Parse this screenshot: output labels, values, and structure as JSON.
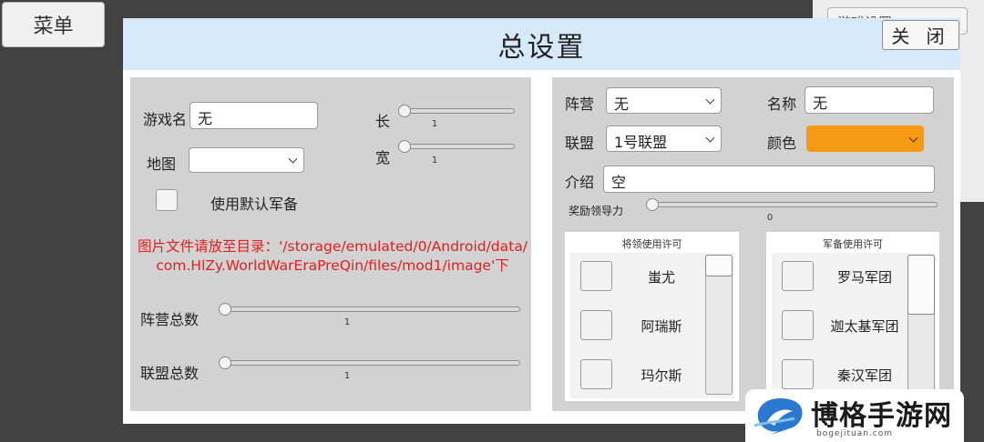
{
  "background": {
    "menu_button_label": "菜单",
    "right_dropdown_label": "游戏设置"
  },
  "dialog": {
    "title": "总设置",
    "close_label": "关 闭"
  },
  "left_panel": {
    "game_name_label": "游戏名",
    "game_name_value": "无",
    "length_label": "长",
    "length_value": "1",
    "width_label": "宽",
    "width_value": "1",
    "map_label": "地图",
    "map_value": "",
    "default_army_label": "使用默认军备",
    "default_army_checked": false,
    "image_notice_line1": "图片文件请放至目录：'/storage/emulated/0/Android/data/",
    "image_notice_line2": "com.HlZy.WorldWarEraPreQin/files/mod1/image'下",
    "notice_color": "#e02020",
    "faction_total_label": "阵营总数",
    "faction_total_value": "1",
    "alliance_total_label": "联盟总数",
    "alliance_total_value": "1"
  },
  "right_panel": {
    "camp_label": "阵营",
    "camp_value": "无",
    "name_label": "名称",
    "name_value": "无",
    "alliance_label": "联盟",
    "alliance_value": "1号联盟",
    "color_label": "颜色",
    "color_value": "#f59a12",
    "intro_label": "介绍",
    "intro_value": "空",
    "leadership_label": "奖励领导力",
    "leadership_value": "0",
    "general_permission": {
      "title": "将领使用许可",
      "items": [
        "蚩尤",
        "阿瑞斯",
        "玛尔斯"
      ]
    },
    "army_permission": {
      "title": "军备使用许可",
      "items": [
        "罗马军团",
        "迦太基军团",
        "秦汉军团"
      ]
    }
  },
  "watermark": {
    "text": "博格手游网",
    "sub": "bogejituan.com"
  },
  "colors": {
    "header_bg": "#d6e9fa",
    "panel_bg": "#d2d2d2",
    "backdrop": "#424242"
  }
}
